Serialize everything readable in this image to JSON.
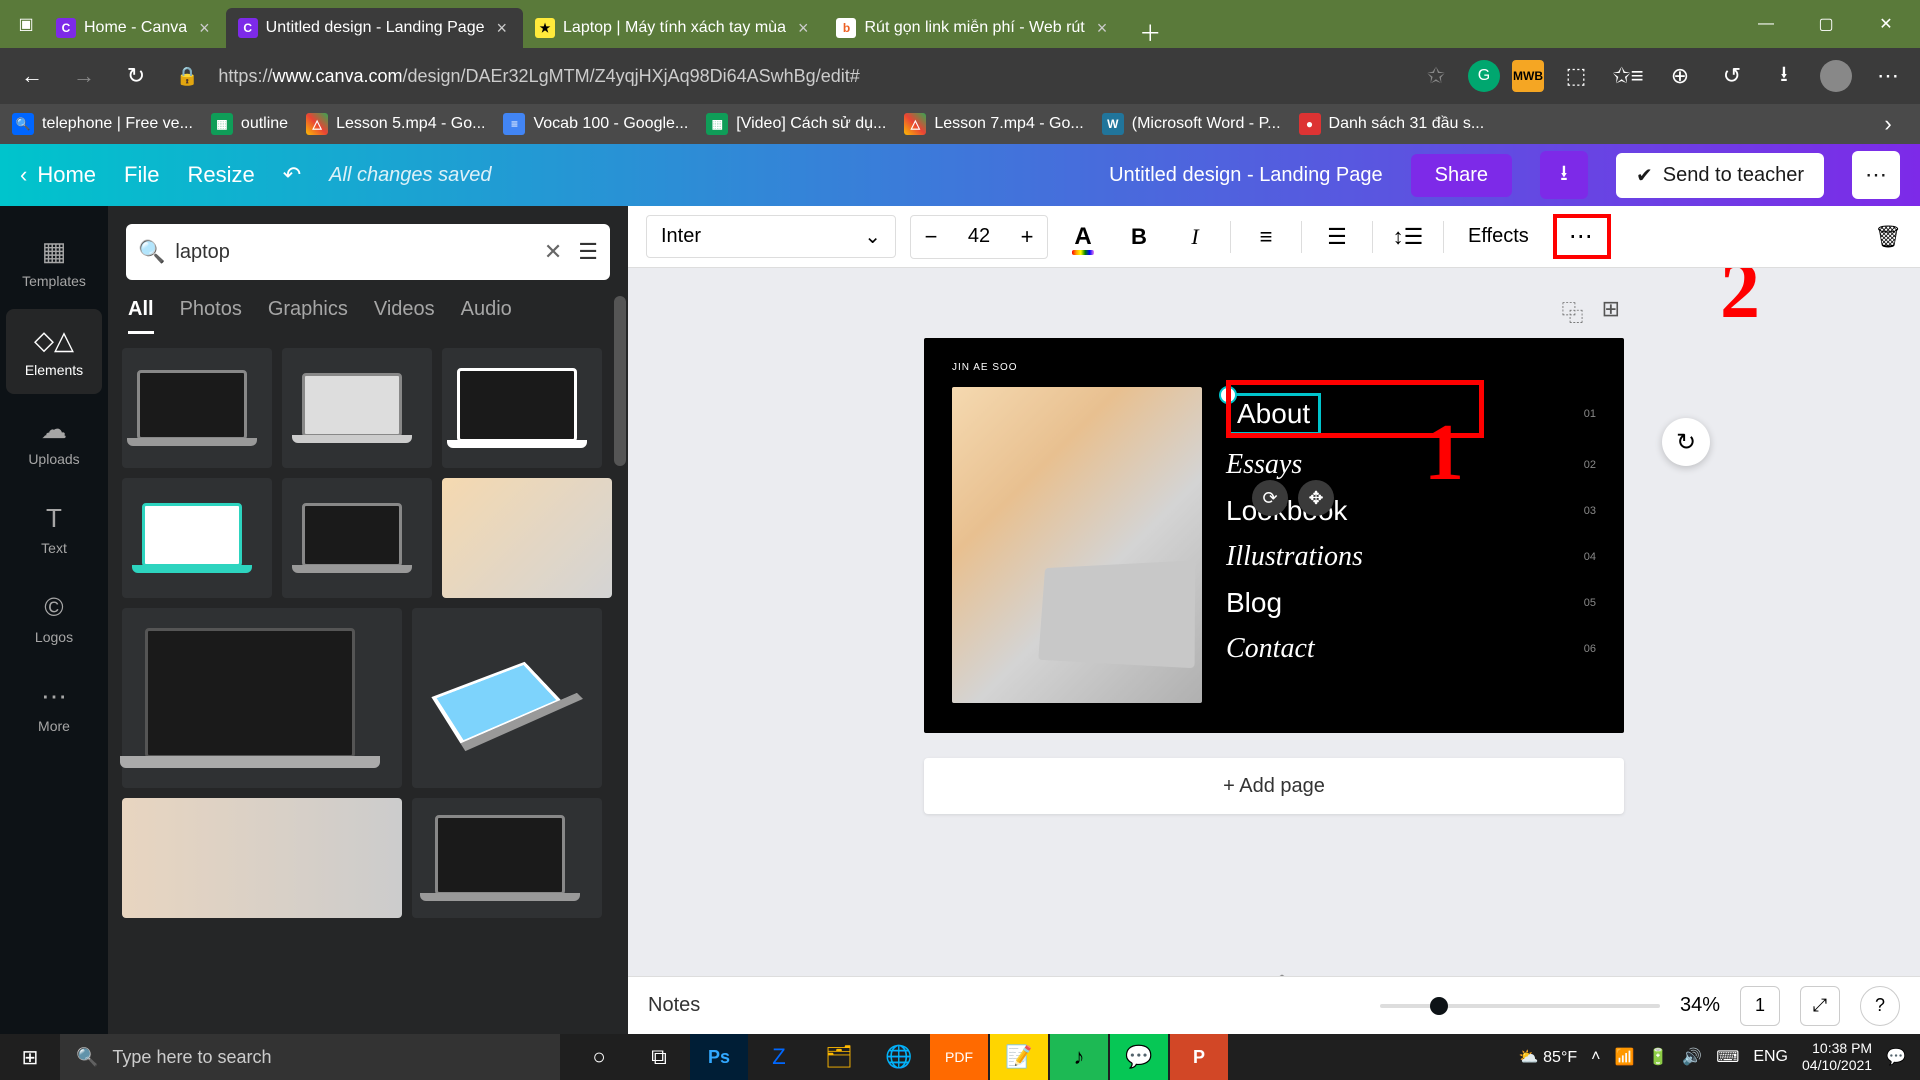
{
  "browser": {
    "tabs": [
      {
        "title": "Home - Canva",
        "favicon": "canva"
      },
      {
        "title": "Untitled design - Landing Page",
        "favicon": "canva",
        "active": true
      },
      {
        "title": "Laptop | Máy tính xách tay mùa",
        "favicon": "yellow"
      },
      {
        "title": "Rút gọn link miễn phí - Web rút",
        "favicon": "bitly"
      }
    ],
    "url_prefix": "https://",
    "url_host": "www.canva.com",
    "url_path": "/design/DAEr32LgMTM/Z4yqjHXjAq98Di64ASwhBg/edit#",
    "bookmarks": [
      {
        "label": "telephone | Free ve...",
        "icon": "🟦"
      },
      {
        "label": "outline",
        "icon": "sheets"
      },
      {
        "label": "Lesson 5.mp4 - Go...",
        "icon": "drive"
      },
      {
        "label": "Vocab 100 - Google...",
        "icon": "docs"
      },
      {
        "label": "[Video] Cách sử dụ...",
        "icon": "sheets"
      },
      {
        "label": "Lesson 7.mp4 - Go...",
        "icon": "drive"
      },
      {
        "label": "(Microsoft Word - P...",
        "icon": "wp"
      },
      {
        "label": "Danh sách 31 đầu s...",
        "icon": "red"
      }
    ]
  },
  "canva": {
    "home": "Home",
    "file": "File",
    "resize": "Resize",
    "saved": "All changes saved",
    "doc_title": "Untitled design - Landing Page",
    "share": "Share",
    "send_teacher": "Send to teacher"
  },
  "sidebar": {
    "items": [
      {
        "label": "Templates",
        "icon": "▦"
      },
      {
        "label": "Elements",
        "icon": "◇△",
        "active": true
      },
      {
        "label": "Uploads",
        "icon": "☁"
      },
      {
        "label": "Text",
        "icon": "T"
      },
      {
        "label": "Logos",
        "icon": "©"
      },
      {
        "label": "More",
        "icon": "⋯"
      }
    ]
  },
  "panel": {
    "search_value": "laptop",
    "tabs": [
      "All",
      "Photos",
      "Graphics",
      "Videos",
      "Audio"
    ],
    "active_tab": "All"
  },
  "toolbar": {
    "font": "Inter",
    "size": "42",
    "minus": "−",
    "plus": "+",
    "bold": "B",
    "italic": "I",
    "effects": "Effects"
  },
  "page": {
    "brand": "JIN AE SOO",
    "menu": [
      {
        "label": "About",
        "num": "01",
        "selected": true,
        "sans": true
      },
      {
        "label": "Essays",
        "num": "02",
        "serif": true
      },
      {
        "label": "Lookbook",
        "num": "03",
        "sans": true
      },
      {
        "label": "Illustrations",
        "num": "04",
        "serif": true
      },
      {
        "label": "Blog",
        "num": "05",
        "sans": true
      },
      {
        "label": "Contact",
        "num": "06",
        "serif": true
      }
    ],
    "add_page": "+ Add page"
  },
  "footer": {
    "notes": "Notes",
    "zoom": "34%",
    "pages": "1"
  },
  "annotations": {
    "one": "1",
    "two": "2"
  },
  "taskbar": {
    "search_placeholder": "Type here to search",
    "weather": "85°F",
    "lang": "ENG",
    "time": "10:38 PM",
    "date": "04/10/2021"
  }
}
